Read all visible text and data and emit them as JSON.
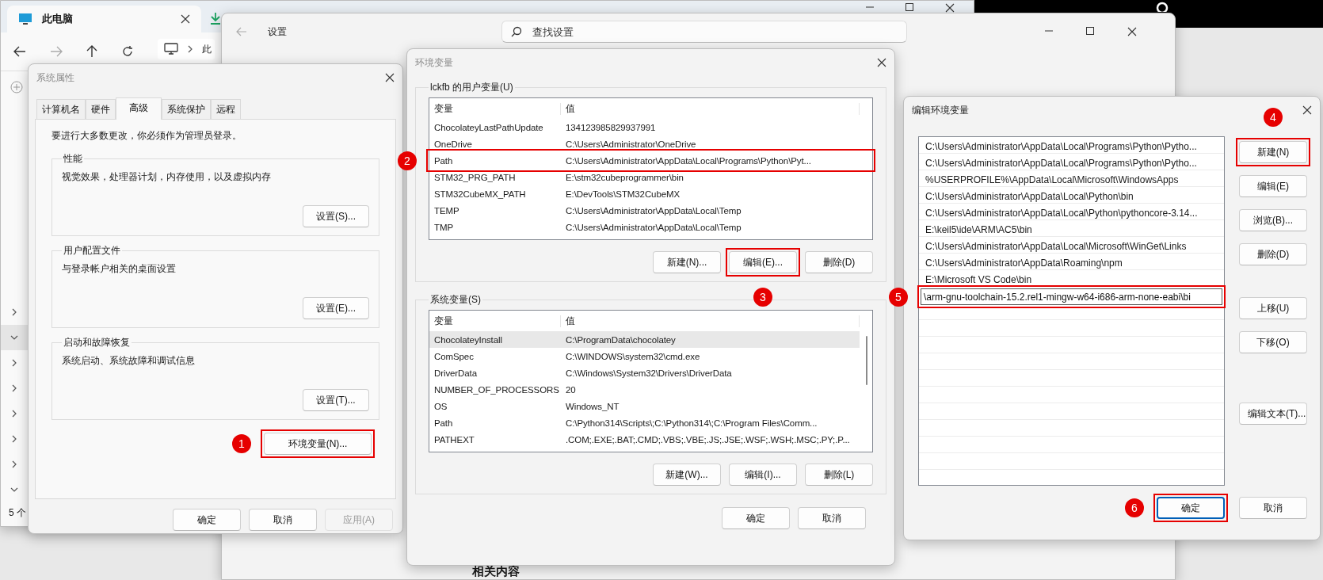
{
  "explorer": {
    "tab_title": "此电脑",
    "breadcrumb": "此",
    "status": "5 个"
  },
  "settings": {
    "title": "设置",
    "search": {
      "placeholder": "查找设置"
    },
    "section_heading": "相关内容"
  },
  "system_properties": {
    "title": "系统属性",
    "tabs": [
      {
        "label": "计算机名",
        "selected": false
      },
      {
        "label": "硬件",
        "selected": false
      },
      {
        "label": "高级",
        "selected": true
      },
      {
        "label": "系统保护",
        "selected": false
      },
      {
        "label": "远程",
        "selected": false
      }
    ],
    "notice": "要进行大多数更改，你必须作为管理员登录。",
    "groups": [
      {
        "title": "性能",
        "description": "视觉效果，处理器计划，内存使用，以及虚拟内存",
        "button": "设置(S)..."
      },
      {
        "title": "用户配置文件",
        "description": "与登录帐户相关的桌面设置",
        "button": "设置(E)..."
      },
      {
        "title": "启动和故障恢复",
        "description": "系统启动、系统故障和调试信息",
        "button": "设置(T)..."
      }
    ],
    "env_button": {
      "label": "环境变量(N)...",
      "callout": "1"
    },
    "buttons": [
      {
        "label": "确定",
        "disabled": false
      },
      {
        "label": "取消",
        "disabled": false
      },
      {
        "label": "应用(A)",
        "disabled": true
      }
    ]
  },
  "environment_variables": {
    "title": "环境变量",
    "user_group": {
      "title": "lckfb 的用户变量(U)",
      "columns": [
        "变量",
        "值"
      ],
      "rows": [
        {
          "name": "ChocolateyLastPathUpdate",
          "value": "134123985829937991",
          "selected": false
        },
        {
          "name": "OneDrive",
          "value": "C:\\Users\\Administrator\\OneDrive",
          "selected": false
        },
        {
          "name": "Path",
          "value": "C:\\Users\\Administrator\\AppData\\Local\\Programs\\Python\\Pyt...",
          "selected": false,
          "callout": "2"
        },
        {
          "name": "STM32_PRG_PATH",
          "value": "E:\\stm32cubeprogrammer\\bin",
          "selected": false
        },
        {
          "name": "STM32CubeMX_PATH",
          "value": "E:\\DevTools\\STM32CubeMX",
          "selected": false
        },
        {
          "name": "TEMP",
          "value": "C:\\Users\\Administrator\\AppData\\Local\\Temp",
          "selected": false
        },
        {
          "name": "TMP",
          "value": "C:\\Users\\Administrator\\AppData\\Local\\Temp",
          "selected": false
        }
      ],
      "buttons": [
        {
          "label": "新建(N)..."
        },
        {
          "label": "编辑(E)...",
          "callout": "3"
        },
        {
          "label": "删除(D)"
        }
      ]
    },
    "system_group": {
      "title": "系统变量(S)",
      "columns": [
        "变量",
        "值"
      ],
      "rows": [
        {
          "name": "ChocolateyInstall",
          "value": "C:\\ProgramData\\chocolatey",
          "selected": true
        },
        {
          "name": "ComSpec",
          "value": "C:\\WINDOWS\\system32\\cmd.exe",
          "selected": false
        },
        {
          "name": "DriverData",
          "value": "C:\\Windows\\System32\\Drivers\\DriverData",
          "selected": false
        },
        {
          "name": "NUMBER_OF_PROCESSORS",
          "value": "20",
          "selected": false
        },
        {
          "name": "OS",
          "value": "Windows_NT",
          "selected": false
        },
        {
          "name": "Path",
          "value": "C:\\Python314\\Scripts\\;C:\\Python314\\;C:\\Program Files\\Comm...",
          "selected": false
        },
        {
          "name": "PATHEXT",
          "value": ".COM;.EXE;.BAT;.CMD;.VBS;.VBE;.JS;.JSE;.WSF;.WSH;.MSC;.PY;.P...",
          "selected": false
        }
      ],
      "buttons": [
        {
          "label": "新建(W)..."
        },
        {
          "label": "编辑(I)..."
        },
        {
          "label": "删除(L)"
        }
      ]
    },
    "buttons": [
      {
        "label": "确定"
      },
      {
        "label": "取消"
      }
    ]
  },
  "edit_variable": {
    "title": "编辑环境变量",
    "entries": [
      {
        "kind": "text",
        "text": "C:\\Users\\Administrator\\AppData\\Local\\Programs\\Python\\Pytho..."
      },
      {
        "kind": "text",
        "text": "C:\\Users\\Administrator\\AppData\\Local\\Programs\\Python\\Pytho..."
      },
      {
        "kind": "text",
        "text": "%USERPROFILE%\\AppData\\Local\\Microsoft\\WindowsApps"
      },
      {
        "kind": "text",
        "text": "C:\\Users\\Administrator\\AppData\\Local\\Python\\bin"
      },
      {
        "kind": "text",
        "text": "C:\\Users\\Administrator\\AppData\\Local\\Python\\pythoncore-3.14..."
      },
      {
        "kind": "text",
        "text": "E:\\keil5\\ide\\ARM\\AC5\\bin"
      },
      {
        "kind": "text",
        "text": "C:\\Users\\Administrator\\AppData\\Local\\Microsoft\\WinGet\\Links"
      },
      {
        "kind": "text",
        "text": "C:\\Users\\Administrator\\AppData\\Roaming\\npm"
      },
      {
        "kind": "text",
        "text": "E:\\Microsoft VS Code\\bin"
      },
      {
        "kind": "input",
        "text": "\\arm-gnu-toolchain-15.2.rel1-mingw-w64-i686-arm-none-eabi\\bi",
        "callout": "5"
      }
    ],
    "button_groups": [
      [
        {
          "label": "新建(N)",
          "callout": "4"
        },
        {
          "label": "编辑(E)"
        },
        {
          "label": "浏览(B)..."
        },
        {
          "label": "删除(D)"
        }
      ],
      [
        {
          "label": "上移(U)"
        },
        {
          "label": "下移(O)"
        }
      ],
      [
        {
          "label": "编辑文本(T)..."
        }
      ]
    ],
    "footer_buttons": [
      {
        "label": "确定",
        "default": true,
        "callout": "6"
      },
      {
        "label": "取消",
        "default": false
      }
    ]
  }
}
